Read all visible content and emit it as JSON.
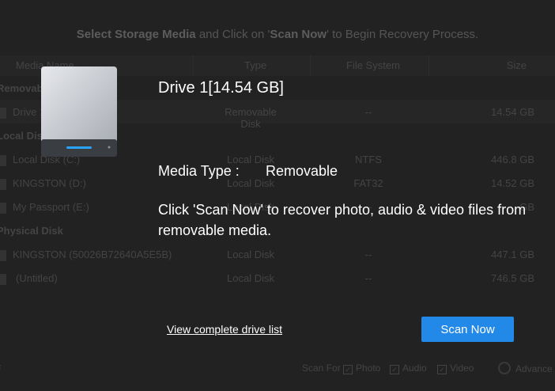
{
  "background": {
    "instruction": {
      "part1": "Select Storage Media",
      "part2": " and Click on '",
      "part3": "Scan Now",
      "part4": "' to Begin Recovery Process."
    },
    "columns": {
      "name": "Media Name",
      "type": "Type",
      "fs": "File System",
      "size": "Size"
    },
    "groups": {
      "removable": "Removable Disk",
      "local": "Local Disk",
      "physical": "Physical Disk"
    },
    "rows": [
      {
        "name": "Drive 1",
        "type": "Removable Disk",
        "fs": "--",
        "size": "14.54 GB"
      },
      {
        "name": "Local Disk (C:)",
        "type": "Local Disk",
        "fs": "NTFS",
        "size": "446.8 GB"
      },
      {
        "name": "KINGSTON (D:)",
        "type": "Local Disk",
        "fs": "FAT32",
        "size": "14.52 GB"
      },
      {
        "name": "My Passport (E:)",
        "type": "Local Disk",
        "fs": "--",
        "size": "GB"
      },
      {
        "name": "KINGSTON (50026B72640A5E5B)",
        "type": "Local Disk",
        "fs": "--",
        "size": "447.1 GB"
      },
      {
        "name": "(Untitled)",
        "type": "Local Disk",
        "fs": "--",
        "size": "746.5 GB"
      }
    ],
    "scan_for": {
      "label": "Scan For",
      "photo": "Photo",
      "audio": "Audio",
      "video": "Video",
      "check_mark": "✓",
      "advanced": "Advance"
    }
  },
  "overlay": {
    "drive_title": "Drive 1[14.54 GB]",
    "media_type_label": "Media Type :",
    "media_type_value": "Removable",
    "description": "Click 'Scan Now' to recover photo, audio & video files from removable media.",
    "view_link": "View complete drive list",
    "scan_button": "Scan Now",
    "drive_icon": "removable-drive-icon"
  },
  "colors": {
    "accent": "#2389e8",
    "overlay_text": "#ffffff",
    "background": "#1e1e1e"
  }
}
